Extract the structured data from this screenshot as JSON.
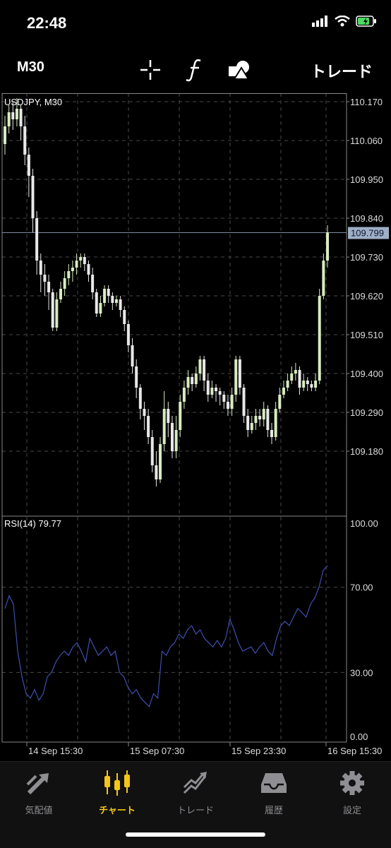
{
  "status": {
    "time": "22:48"
  },
  "toolbar": {
    "timeframe": "M30",
    "crosshair_icon": "crosshair-icon",
    "indicator_icon": "function-icon",
    "objects_icon": "shapes-icon",
    "trade_label": "トレード"
  },
  "chart": {
    "title": "USDJPY, M30",
    "current_price": "109.799",
    "rsi_title": "RSI(14) 79.77",
    "colors": {
      "bull": "#d7ecc0",
      "bear": "#e8e8e8",
      "rsi": "#3f4fb0",
      "price_line": "#7d8ca3"
    }
  },
  "chart_data": [
    {
      "type": "candlestick",
      "title": "USDJPY, M30",
      "ylim": [
        109.08,
        110.19
      ],
      "y_ticks": [
        "110.170",
        "110.060",
        "109.950",
        "109.840",
        "109.730",
        "109.620",
        "109.510",
        "109.400",
        "109.290",
        "109.180"
      ],
      "x_ticks": [
        "14 Sep 15:30",
        "15 Sep 07:30",
        "15 Sep 23:30",
        "16 Sep 15:30"
      ],
      "last_price": 109.799,
      "candles": [
        [
          110.05,
          110.1,
          110.13,
          110.02
        ],
        [
          110.1,
          110.14,
          110.16,
          110.08
        ],
        [
          110.14,
          110.12,
          110.17,
          110.09
        ],
        [
          110.12,
          110.15,
          110.18,
          110.1
        ],
        [
          110.15,
          110.1,
          110.16,
          110.06
        ],
        [
          110.1,
          110.02,
          110.13,
          109.99
        ],
        [
          110.02,
          109.96,
          110.04,
          109.9
        ],
        [
          109.96,
          109.84,
          109.98,
          109.8
        ],
        [
          109.84,
          109.72,
          109.86,
          109.68
        ],
        [
          109.72,
          109.68,
          109.74,
          109.63
        ],
        [
          109.68,
          109.66,
          109.71,
          109.62
        ],
        [
          109.66,
          109.63,
          109.68,
          109.58
        ],
        [
          109.63,
          109.53,
          109.64,
          109.52
        ],
        [
          109.53,
          109.61,
          109.63,
          109.52
        ],
        [
          109.61,
          109.64,
          109.66,
          109.6
        ],
        [
          109.64,
          109.67,
          109.69,
          109.62
        ],
        [
          109.67,
          109.69,
          109.71,
          109.65
        ],
        [
          109.69,
          109.7,
          109.72,
          109.66
        ],
        [
          109.7,
          109.72,
          109.74,
          109.68
        ],
        [
          109.72,
          109.73,
          109.74,
          109.7
        ],
        [
          109.73,
          109.71,
          109.74,
          109.69
        ],
        [
          109.71,
          109.68,
          109.72,
          109.66
        ],
        [
          109.68,
          109.63,
          109.7,
          109.61
        ],
        [
          109.63,
          109.57,
          109.64,
          109.56
        ],
        [
          109.57,
          109.6,
          109.62,
          109.56
        ],
        [
          109.6,
          109.64,
          109.65,
          109.59
        ],
        [
          109.64,
          109.62,
          109.65,
          109.6
        ],
        [
          109.62,
          109.6,
          109.63,
          109.58
        ],
        [
          109.6,
          109.61,
          109.62,
          109.59
        ],
        [
          109.61,
          109.58,
          109.62,
          109.56
        ],
        [
          109.58,
          109.54,
          109.59,
          109.52
        ],
        [
          109.54,
          109.48,
          109.55,
          109.46
        ],
        [
          109.48,
          109.42,
          109.5,
          109.4
        ],
        [
          109.42,
          109.36,
          109.44,
          109.33
        ],
        [
          109.36,
          109.3,
          109.37,
          109.27
        ],
        [
          109.3,
          109.28,
          109.32,
          109.24
        ],
        [
          109.28,
          109.22,
          109.3,
          109.2
        ],
        [
          109.22,
          109.14,
          109.24,
          109.12
        ],
        [
          109.14,
          109.1,
          109.18,
          109.08
        ],
        [
          109.1,
          109.2,
          109.22,
          109.09
        ],
        [
          109.2,
          109.3,
          109.35,
          109.18
        ],
        [
          109.3,
          109.26,
          109.32,
          109.22
        ],
        [
          109.26,
          109.18,
          109.28,
          109.16
        ],
        [
          109.18,
          109.24,
          109.28,
          109.16
        ],
        [
          109.24,
          109.32,
          109.34,
          109.22
        ],
        [
          109.32,
          109.36,
          109.38,
          109.3
        ],
        [
          109.36,
          109.39,
          109.41,
          109.34
        ],
        [
          109.39,
          109.37,
          109.4,
          109.35
        ],
        [
          109.37,
          109.4,
          109.42,
          109.36
        ],
        [
          109.4,
          109.44,
          109.45,
          109.38
        ],
        [
          109.44,
          109.38,
          109.45,
          109.35
        ],
        [
          109.38,
          109.34,
          109.4,
          109.32
        ],
        [
          109.34,
          109.36,
          109.38,
          109.33
        ],
        [
          109.36,
          109.35,
          109.37,
          109.32
        ],
        [
          109.35,
          109.34,
          109.36,
          109.31
        ],
        [
          109.34,
          109.32,
          109.35,
          109.3
        ],
        [
          109.32,
          109.3,
          109.34,
          109.28
        ],
        [
          109.3,
          109.34,
          109.36,
          109.28
        ],
        [
          109.34,
          109.44,
          109.45,
          109.32
        ],
        [
          109.44,
          109.36,
          109.45,
          109.34
        ],
        [
          109.36,
          109.28,
          109.37,
          109.26
        ],
        [
          109.28,
          109.24,
          109.3,
          109.22
        ],
        [
          109.24,
          109.26,
          109.28,
          109.23
        ],
        [
          109.26,
          109.28,
          109.3,
          109.24
        ],
        [
          109.28,
          109.27,
          109.3,
          109.25
        ],
        [
          109.27,
          109.3,
          109.32,
          109.25
        ],
        [
          109.3,
          109.24,
          109.31,
          109.22
        ],
        [
          109.24,
          109.22,
          109.26,
          109.2
        ],
        [
          109.22,
          109.3,
          109.32,
          109.21
        ],
        [
          109.3,
          109.34,
          109.36,
          109.29
        ],
        [
          109.34,
          109.36,
          109.38,
          109.33
        ],
        [
          109.36,
          109.38,
          109.4,
          109.35
        ],
        [
          109.38,
          109.4,
          109.42,
          109.37
        ],
        [
          109.4,
          109.41,
          109.43,
          109.38
        ],
        [
          109.41,
          109.36,
          109.42,
          109.34
        ],
        [
          109.36,
          109.38,
          109.4,
          109.35
        ],
        [
          109.38,
          109.37,
          109.39,
          109.35
        ],
        [
          109.37,
          109.36,
          109.38,
          109.35
        ],
        [
          109.36,
          109.38,
          109.4,
          109.35
        ],
        [
          109.38,
          109.62,
          109.64,
          109.37
        ],
        [
          109.62,
          109.72,
          109.74,
          109.61
        ],
        [
          109.72,
          109.8,
          109.82,
          109.7
        ]
      ]
    },
    {
      "type": "line",
      "title": "RSI(14) 79.77",
      "ylim": [
        0,
        100
      ],
      "y_ticks": [
        "100.00",
        "70.00",
        "30.00",
        "0.00"
      ],
      "series": [
        {
          "values": [
            60,
            66,
            62,
            40,
            28,
            20,
            18,
            22,
            17,
            20,
            28,
            30,
            35,
            38,
            40,
            38,
            42,
            44,
            40,
            35,
            46,
            42,
            38,
            40,
            42,
            38,
            40,
            30,
            28,
            23,
            20,
            22,
            18,
            16,
            14,
            20,
            18,
            40,
            38,
            42,
            44,
            48,
            46,
            50,
            52,
            48,
            50,
            46,
            44,
            42,
            45,
            42,
            46,
            55,
            50,
            44,
            40,
            41,
            42,
            39,
            42,
            44,
            40,
            38,
            46,
            52,
            54,
            52,
            56,
            60,
            58,
            56,
            62,
            65,
            70,
            78,
            80
          ]
        }
      ]
    }
  ],
  "tabs": [
    {
      "label": "気配値",
      "icon": "quotes-icon",
      "active": false
    },
    {
      "label": "チャート",
      "icon": "chart-icon",
      "active": true
    },
    {
      "label": "トレード",
      "icon": "trade-icon",
      "active": false
    },
    {
      "label": "履歴",
      "icon": "history-icon",
      "active": false
    },
    {
      "label": "設定",
      "icon": "settings-icon",
      "active": false
    }
  ]
}
